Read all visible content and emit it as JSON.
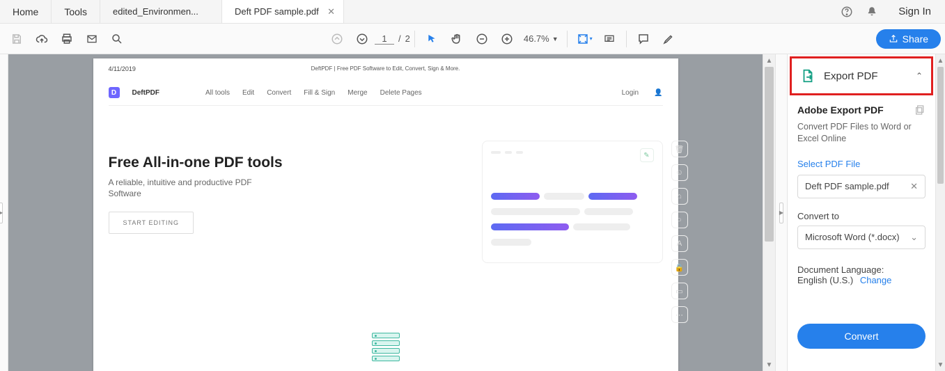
{
  "topbar": {
    "home": "Home",
    "tools": "Tools",
    "tabs": [
      {
        "label": "edited_Environmen..."
      },
      {
        "label": "Deft PDF sample.pdf"
      }
    ],
    "signin": "Sign In"
  },
  "toolbar": {
    "page_current": "1",
    "page_sep": "/",
    "page_total": "2",
    "zoom": "46.7%",
    "share": "Share"
  },
  "document": {
    "date": "4/11/2019",
    "header": "DeftPDF | Free PDF Software to Edit, Convert, Sign & More.",
    "brand": "DeftPDF",
    "nav": [
      "All tools",
      "Edit",
      "Convert",
      "Fill & Sign",
      "Merge",
      "Delete Pages"
    ],
    "login": "Login",
    "hero_title": "Free All-in-one PDF tools",
    "hero_sub": "A reliable, intuitive and productive PDF Software",
    "hero_btn": "START EDITING"
  },
  "rightPanel": {
    "exportHeader": "Export PDF",
    "title": "Adobe Export PDF",
    "subtitle": "Convert PDF Files to Word or Excel Online",
    "selectLabel": "Select PDF File",
    "selectedFile": "Deft PDF sample.pdf",
    "convertToLabel": "Convert to",
    "convertToValue": "Microsoft Word (*.docx)",
    "langLabel": "Document Language:",
    "langValue": "English (U.S.)",
    "langChange": "Change",
    "convertBtn": "Convert"
  }
}
